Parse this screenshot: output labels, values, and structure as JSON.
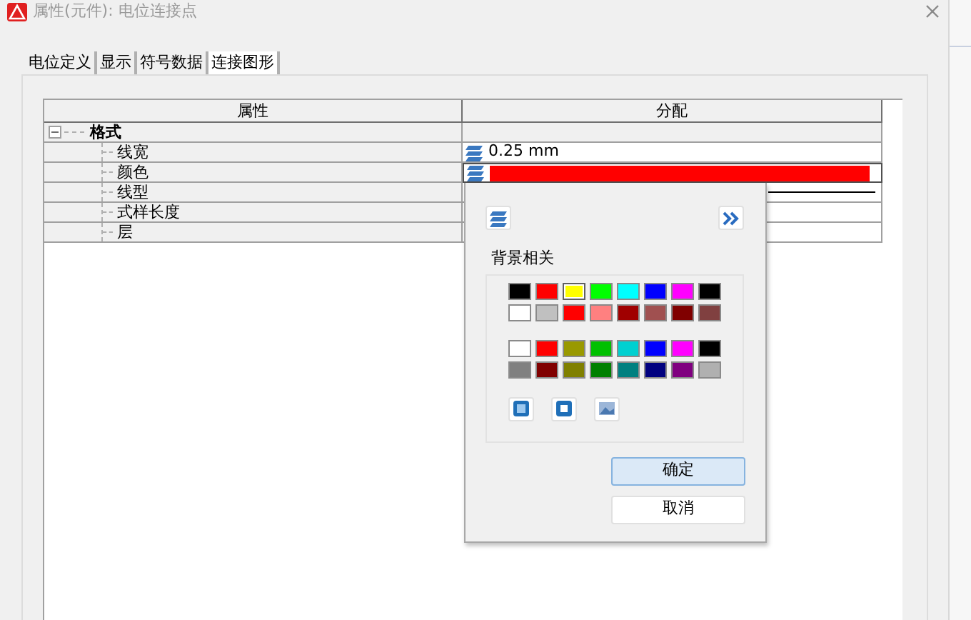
{
  "window": {
    "title": "属性(元件): 电位连接点"
  },
  "tabs": [
    {
      "label": "电位定义",
      "selected": false
    },
    {
      "label": "显示",
      "selected": false
    },
    {
      "label": "符号数据",
      "selected": false
    },
    {
      "label": "连接图形",
      "selected": true
    }
  ],
  "grid": {
    "columns": [
      "属性",
      "分配"
    ],
    "rows": [
      {
        "label": "格式",
        "expanded": true,
        "children": [
          {
            "label": "线宽",
            "selected": false,
            "value": {
              "kind": "text",
              "text": "0.25 mm"
            }
          },
          {
            "label": "颜色",
            "selected": true,
            "value": {
              "kind": "color",
              "color": "#ff0000"
            }
          },
          {
            "label": "线型",
            "selected": false,
            "value": {
              "kind": "line"
            }
          },
          {
            "label": "式样长度",
            "selected": false
          },
          {
            "label": "层",
            "selected": false
          }
        ]
      }
    ]
  },
  "color_popup": {
    "group_label": "背景相关",
    "palettes": [
      [
        {
          "color": "#000000",
          "selected": false
        },
        {
          "color": "#ff0000",
          "selected": false
        },
        {
          "color": "#ffff00",
          "selected": true
        },
        {
          "color": "#00ff00",
          "selected": false
        },
        {
          "color": "#00ffff",
          "selected": false
        },
        {
          "color": "#0000ff",
          "selected": false
        },
        {
          "color": "#ff00ff",
          "selected": false
        },
        {
          "color": "#000000",
          "selected": false
        },
        {
          "color": "#ffffff",
          "selected": false
        },
        {
          "color": "#c0c0c0",
          "selected": false
        },
        {
          "color": "#ff0000",
          "selected": false
        },
        {
          "color": "#ff8080",
          "selected": false
        },
        {
          "color": "#a00000",
          "selected": false
        },
        {
          "color": "#a05050",
          "selected": false
        },
        {
          "color": "#800000",
          "selected": false
        },
        {
          "color": "#804040",
          "selected": false
        }
      ],
      [
        {
          "color": "#ffffff",
          "selected": false
        },
        {
          "color": "#ff0000",
          "selected": false
        },
        {
          "color": "#999900",
          "selected": false
        },
        {
          "color": "#00c000",
          "selected": false
        },
        {
          "color": "#00d0d0",
          "selected": false
        },
        {
          "color": "#0000ff",
          "selected": false
        },
        {
          "color": "#ff00ff",
          "selected": false
        },
        {
          "color": "#000000",
          "selected": false
        },
        {
          "color": "#808080",
          "selected": false
        },
        {
          "color": "#800000",
          "selected": false
        },
        {
          "color": "#808000",
          "selected": false
        },
        {
          "color": "#008000",
          "selected": false
        },
        {
          "color": "#008080",
          "selected": false
        },
        {
          "color": "#000080",
          "selected": false
        },
        {
          "color": "#800080",
          "selected": false
        },
        {
          "color": "#b0b0b0",
          "selected": false
        }
      ]
    ],
    "buttons": [
      {
        "label": "确定",
        "default": true
      },
      {
        "label": "取消",
        "default": false
      }
    ]
  }
}
